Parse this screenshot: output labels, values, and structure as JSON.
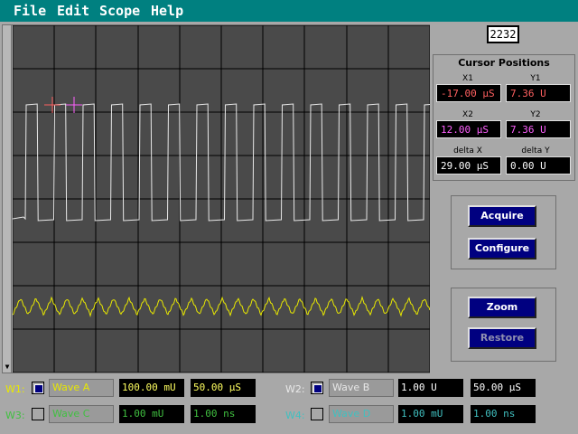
{
  "menu": {
    "file": "File",
    "edit": "Edit",
    "scope": "Scope",
    "help": "Help"
  },
  "counter": "2232",
  "cursors": {
    "title": "Cursor Positions",
    "x1_label": "X1",
    "x1": "-17.00 µS",
    "y1_label": "Y1",
    "y1": "7.36 U",
    "x2_label": "X2",
    "x2": "12.00 µS",
    "y2_label": "Y2",
    "y2": "7.36 U",
    "dx_label": "delta X",
    "dx": "29.00 µS",
    "dy_label": "delta Y",
    "dy": "0.00 U"
  },
  "buttons": {
    "acquire": "Acquire",
    "configure": "Configure",
    "zoom": "Zoom",
    "restore": "Restore"
  },
  "waves": [
    {
      "label": "W1:",
      "checked": true,
      "name": "Wave A",
      "volts": "100.00 mU",
      "time": "50.00 µS"
    },
    {
      "label": "W2:",
      "checked": true,
      "name": "Wave B",
      "volts": "1.00 U",
      "time": "50.00 µS"
    },
    {
      "label": "W3:",
      "checked": false,
      "name": "Wave C",
      "volts": "1.00 mU",
      "time": "1.00 ns"
    },
    {
      "label": "W4:",
      "checked": false,
      "name": "Wave D",
      "volts": "1.00 mU",
      "time": "1.00 ns"
    }
  ],
  "colors": {
    "menubar": "#008080",
    "screen": "#4a4a4a",
    "grid": "#000000",
    "square_wave": "#e8e8e8",
    "triangle_wave": "#e8e800",
    "cursor1": "#ff6060",
    "cursor2": "#ff60ff",
    "w1_label": "#e8e800",
    "w2_label": "#e8e8e8",
    "w3_label": "#40c040",
    "w4_label": "#40c0c0",
    "x1_text": "#ff6060",
    "y1_text": "#ff6060",
    "x2_text": "#ff60ff",
    "y2_text": "#ff60ff",
    "delta_text": "#ffffff",
    "val_yellow": "#ffff60",
    "val_white": "#ffffff",
    "val_green": "#40c040",
    "val_cyan": "#40c0c0"
  },
  "icons": {
    "scroll_down": "down-arrow-icon"
  }
}
